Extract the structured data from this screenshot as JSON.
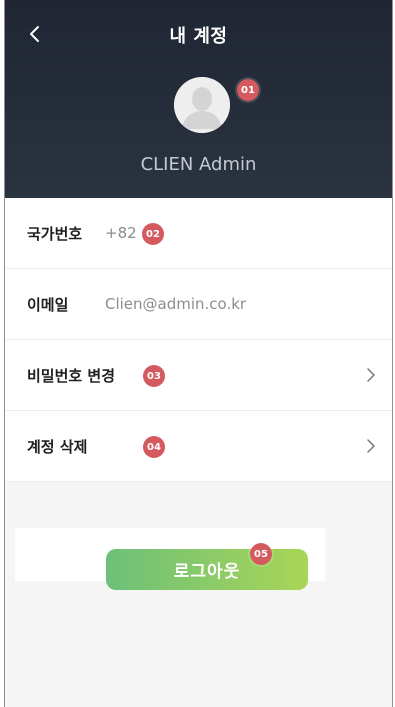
{
  "header": {
    "title": "내 계정",
    "username": "CLIEN Admin",
    "avatar_badge": "01"
  },
  "rows": [
    {
      "label": "국가번호",
      "value": "+82",
      "badge": "02"
    },
    {
      "label": "이메일",
      "value": "Clien@admin.co.kr"
    },
    {
      "label": "비밀번호 변경",
      "badge": "03"
    },
    {
      "label": "계정 삭제",
      "badge": "04"
    }
  ],
  "logout": {
    "label": "로그아웃",
    "badge": "05"
  },
  "colors": {
    "header_bg": "#222a36",
    "badge": "#d55a5f",
    "logout_gradient_start": "#6dc07a",
    "logout_gradient_end": "#a8d556"
  },
  "icons": {
    "back": "chevron-left-icon",
    "chevron": "chevron-right-icon",
    "avatar": "user-silhouette-icon"
  }
}
